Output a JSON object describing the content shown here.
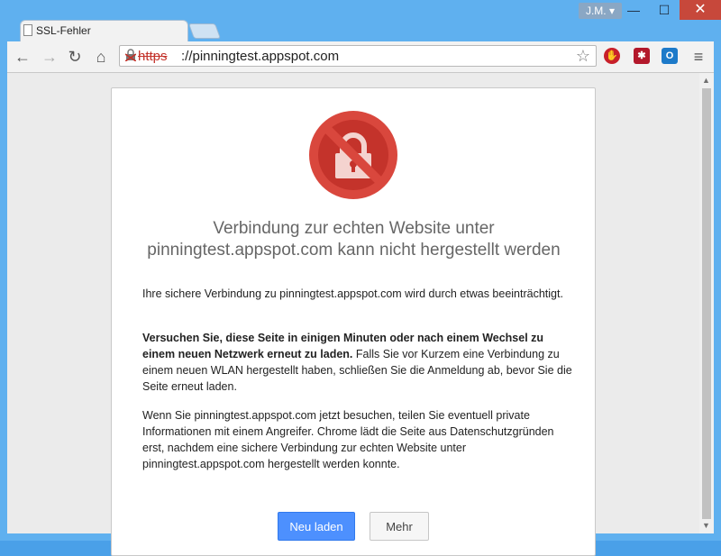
{
  "window": {
    "user_badge": "J.M.",
    "minimize_label": "—",
    "maximize_label": "☐",
    "close_label": "✕"
  },
  "tabs": [
    {
      "label": "SSL-Fehler"
    }
  ],
  "toolbar": {
    "back_icon": "←",
    "forward_icon": "→",
    "reload_icon": "↻",
    "home_icon": "⌂",
    "menu_icon": "≡",
    "url_scheme": "https",
    "url_rest": "://pinningtest.appspot.com",
    "star_icon": "☆",
    "lock_icon": "✕"
  },
  "extensions": [
    {
      "name": "adblock-icon",
      "color": "#c8202a"
    },
    {
      "name": "lastpass-icon",
      "color": "#b3182b"
    },
    {
      "name": "outlook-icon",
      "color": "#1d7ac9"
    }
  ],
  "page": {
    "heading_line1": "Verbindung zur echten Website unter",
    "heading_line2": "pinningtest.appspot.com kann nicht hergestellt werden",
    "p1": "Ihre sichere Verbindung zu pinningtest.appspot.com wird durch etwas beeinträchtigt.",
    "p2_bold": "Versuchen Sie, diese Seite in einigen Minuten oder nach einem Wechsel zu einem neuen Netzwerk erneut zu laden.",
    "p2_rest": " Falls Sie vor Kurzem eine Verbindung zu einem neuen WLAN hergestellt haben, schließen Sie die Anmeldung ab, bevor Sie die Seite erneut laden.",
    "p3": "Wenn Sie pinningtest.appspot.com jetzt besuchen, teilen Sie eventuell private Informationen mit einem Angreifer. Chrome lädt die Seite aus Datenschutzgründen erst, nachdem eine sichere Verbindung zur echten Website unter pinningtest.appspot.com hergestellt werden konnte.",
    "reload_button": "Neu laden",
    "more_button": "Mehr"
  },
  "colors": {
    "error_red": "#d9473d",
    "primary_blue": "#4d90fe"
  }
}
